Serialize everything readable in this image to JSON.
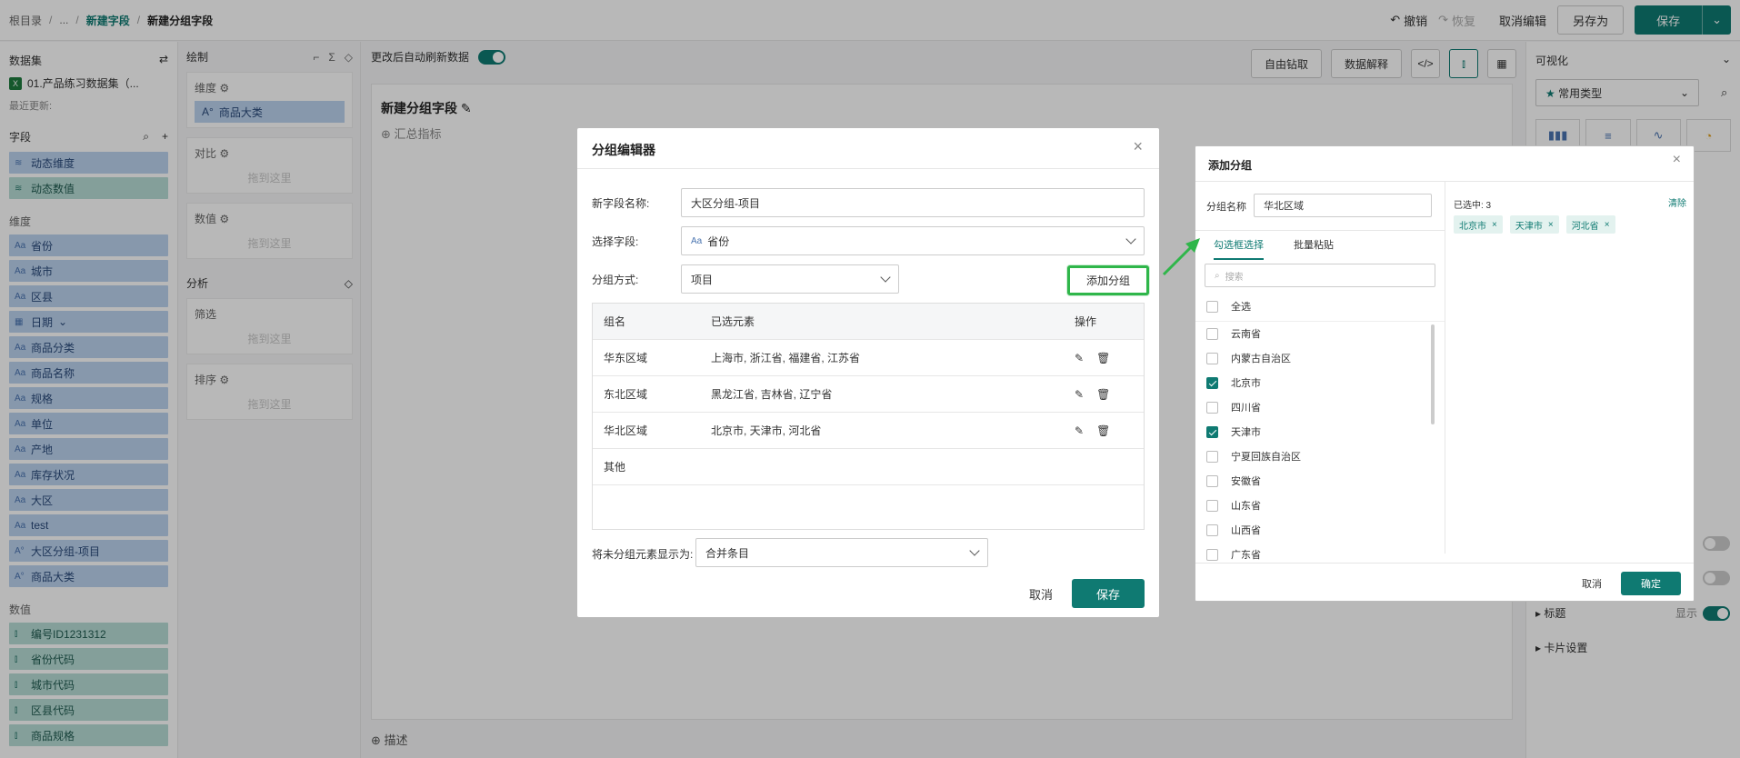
{
  "breadcrumb": {
    "root": "根目录",
    "ellipsis": "...",
    "parent": "新建字段",
    "current": "新建分组字段"
  },
  "top_actions": {
    "undo": "撤销",
    "redo": "恢复",
    "cancel_edit": "取消编辑",
    "save_as": "另存为",
    "save": "保存"
  },
  "left_panel": {
    "dataset_title": "数据集",
    "dataset_name": "01.产品练习数据集（...",
    "last_update": "最近更新:",
    "fields_title": "字段",
    "dynamic": [
      "动态维度",
      "动态数值"
    ],
    "dimension_title": "维度",
    "dimensions": [
      "省份",
      "城市",
      "区县",
      "日期",
      "商品分类",
      "商品名称",
      "规格",
      "单位",
      "产地",
      "库存状况",
      "大区",
      "test",
      "大区分组-项目",
      "商品大类"
    ],
    "measure_title": "数值",
    "measures": [
      "编号ID1231312",
      "省份代码",
      "城市代码",
      "区县代码",
      "商品规格"
    ]
  },
  "config": {
    "draw_title": "绘制",
    "slots": [
      {
        "label": "维度",
        "pill": "商品大类",
        "drop": "拖到这里"
      },
      {
        "label": "对比",
        "drop": "拖到这里"
      },
      {
        "label": "数值",
        "drop": "拖到这里"
      }
    ],
    "analysis_title": "分析",
    "analysis_slots": [
      {
        "label": "筛选",
        "drop": "拖到这里"
      },
      {
        "label": "排序",
        "drop": "拖到这里"
      }
    ]
  },
  "canvas": {
    "auto_refresh": "更改后自动刷新数据",
    "drill": "自由钻取",
    "explain": "数据解释",
    "code_icon": "</>",
    "card_title": "新建分组字段",
    "summary": "汇总指标",
    "describe": "描述"
  },
  "right_panel": {
    "title": "可视化",
    "chart_type": "常用类型",
    "title_row": "标题",
    "title_show": "显示",
    "card_settings": "卡片设置"
  },
  "group_editor": {
    "title": "分组编辑器",
    "name_label": "新字段名称:",
    "name_value": "大区分组-项目",
    "field_label": "选择字段:",
    "field_value": "省份",
    "method_label": "分组方式:",
    "method_value": "项目",
    "add_group": "添加分组",
    "table_headers": [
      "组名",
      "已选元素",
      "操作"
    ],
    "rows": [
      {
        "name": "华东区域",
        "elements": "上海市, 浙江省, 福建省, 江苏省"
      },
      {
        "name": "东北区域",
        "elements": "黑龙江省, 吉林省, 辽宁省"
      },
      {
        "name": "华北区域",
        "elements": "北京市, 天津市, 河北省"
      }
    ],
    "other": "其他",
    "unassigned_label": "将未分组元素显示为:",
    "unassigned_value": "合并条目",
    "cancel": "取消",
    "save": "保存"
  },
  "add_group": {
    "title": "添加分组",
    "name_label": "分组名称",
    "name_value": "华北区域",
    "tab_checkbox": "勾选框选择",
    "tab_paste": "批量粘贴",
    "search_placeholder": "搜索",
    "select_all": "全选",
    "options": [
      {
        "label": "云南省",
        "checked": false
      },
      {
        "label": "内蒙古自治区",
        "checked": false
      },
      {
        "label": "北京市",
        "checked": true
      },
      {
        "label": "四川省",
        "checked": false
      },
      {
        "label": "天津市",
        "checked": true
      },
      {
        "label": "宁夏回族自治区",
        "checked": false
      },
      {
        "label": "安徽省",
        "checked": false
      },
      {
        "label": "山东省",
        "checked": false
      },
      {
        "label": "山西省",
        "checked": false
      },
      {
        "label": "广东省",
        "checked": false
      }
    ],
    "selected_count": "已选中: 3",
    "clear": "清除",
    "selected_tags": [
      "北京市",
      "天津市",
      "河北省"
    ],
    "cancel": "取消",
    "confirm": "确定"
  },
  "colors": {
    "primary": "#0f7a72",
    "highlight": "#2fb64a",
    "dimension": "#bcd3ef",
    "measure": "#b8ddd6"
  }
}
